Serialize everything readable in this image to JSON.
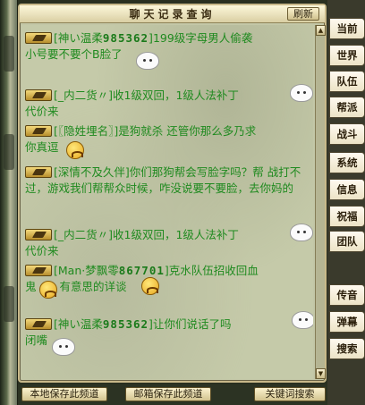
{
  "window": {
    "title": "聊天记录查询",
    "refresh_label": "刷新"
  },
  "messages": [
    {
      "sender": "[神い温柔",
      "digits": "985362",
      "bracket_close": "]",
      "text": "199级字母男人偷袭",
      "continuation": "小号要不要个B脸了"
    },
    {
      "sender": "[_内二货〃]",
      "text": "收1级双回，1级人法补丁",
      "continuation": "代价来"
    },
    {
      "sender": "[〖隐姓埋名〗]",
      "text": "是狗就杀 还管你那么多乃求",
      "continuation": "你真逗"
    },
    {
      "sender": "[深情不及久伴]",
      "text": "你们那狗帮会写脸字吗？帮",
      "continuation": "战打不过，游戏我们帮帮众时候，咋没说要不要脸，去你妈的"
    },
    {
      "sender": "[_内二货〃]",
      "text": "收1级双回，1级人法补丁",
      "continuation": "代价来"
    },
    {
      "sender": "[Man·梦飘零",
      "digits": "867701",
      "bracket_close": "]",
      "text": "克水队伍招收回血",
      "continuation": "鬼",
      "continuation2": "有意思的详谈"
    },
    {
      "sender": "[神い温柔",
      "digits": "985362",
      "bracket_close": "]",
      "text": "让你们说话了吗",
      "continuation": "闭嘴"
    }
  ],
  "tabs": [
    "当前",
    "世界",
    "队伍",
    "帮派",
    "战斗",
    "系统",
    "信息",
    "祝福",
    "团队",
    "传音",
    "弹幕",
    "搜索"
  ],
  "bottom_buttons": {
    "save_channel": "本地保存此频道",
    "mail_channel": "邮箱保存此频道",
    "keyword_search": "关键词搜索"
  },
  "icons": {
    "channel": "speaker-icon",
    "scroll_up": "arrow-up-icon",
    "scroll_down": "arrow-down-icon"
  },
  "colors": {
    "message_text": "#1f8a1f",
    "chat_background": "#c5caa9",
    "frame_border": "#c9b98a"
  }
}
